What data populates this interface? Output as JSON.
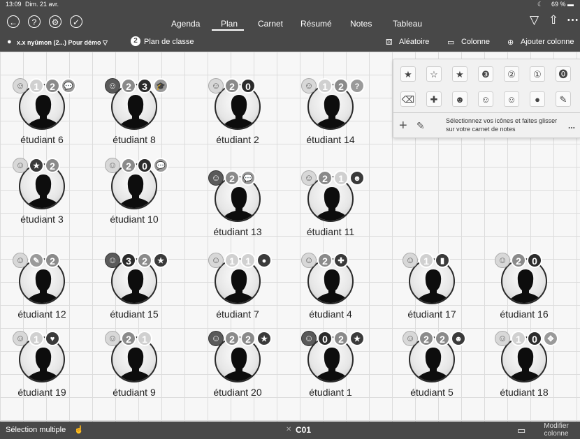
{
  "status": {
    "time": "13:09",
    "date": "Dim. 21 avr.",
    "battery": "69 %"
  },
  "nav": {
    "tabs": [
      {
        "label": "Agenda",
        "active": false
      },
      {
        "label": "Plan",
        "active": true
      },
      {
        "label": "Carnet",
        "active": false
      },
      {
        "label": "Résumé",
        "active": false
      },
      {
        "label": "Notes",
        "active": false
      },
      {
        "label": "Tableau",
        "active": false
      }
    ]
  },
  "subbar": {
    "class_selector": "x.x nyūmon (2...) Pour démo ▽",
    "plan_count": "2",
    "plan_label": "Plan de classe",
    "random_label": "Aléatoire",
    "column_label": "Colonne",
    "add_column_label": "Ajouter colonne"
  },
  "icon_panel": {
    "row1": [
      "star-grey",
      "star-light",
      "star-dark",
      "3",
      "2",
      "1",
      "0"
    ],
    "row2": [
      "delete",
      "plus",
      "smile-dark",
      "smile-mid",
      "smile-light",
      "circle-dark",
      "note"
    ],
    "hint": "Sélectionnez vos icônes et faites glisser sur votre carnet de notes",
    "more": "..."
  },
  "students": [
    {
      "name": "étudiant 6",
      "badges": [
        "smile",
        "1",
        "2",
        "speech"
      ]
    },
    {
      "name": "étudiant 8",
      "badges": [
        "smile-dark",
        "2",
        "3",
        "cap"
      ]
    },
    {
      "name": "étudiant 2",
      "badges": [
        "smile",
        "2",
        "0"
      ]
    },
    {
      "name": "étudiant 14",
      "badges": [
        "smile",
        "1",
        "2",
        "?"
      ]
    },
    {
      "name": "étudiant 3",
      "badges": [
        "smile",
        "star",
        "2"
      ]
    },
    {
      "name": "étudiant 10",
      "badges": [
        "smile",
        "2",
        "0",
        "speech"
      ]
    },
    {
      "name": "étudiant 13",
      "badges": [
        "smile-dark",
        "2",
        "speech"
      ]
    },
    {
      "name": "étudiant 11",
      "badges": [
        "smile",
        "2",
        "1",
        "group"
      ]
    },
    {
      "name": "étudiant 12",
      "badges": [
        "smile",
        "note",
        "2"
      ]
    },
    {
      "name": "étudiant 15",
      "badges": [
        "smile-dark",
        "3",
        "2",
        "star"
      ]
    },
    {
      "name": "étudiant 7",
      "badges": [
        "smile",
        "1",
        "1",
        "circle"
      ]
    },
    {
      "name": "étudiant 4",
      "badges": [
        "smile",
        "2",
        "plus"
      ]
    },
    {
      "name": "étudiant 17",
      "badges": [
        "smile",
        "1",
        "phone"
      ]
    },
    {
      "name": "étudiant 16",
      "badges": [
        "smile",
        "2",
        "0"
      ]
    },
    {
      "name": "étudiant 19",
      "badges": [
        "smile",
        "1",
        "heart"
      ]
    },
    {
      "name": "étudiant 9",
      "badges": [
        "smile",
        "2",
        "1"
      ]
    },
    {
      "name": "étudiant 20",
      "badges": [
        "smile-dark",
        "2",
        "2",
        "star"
      ]
    },
    {
      "name": "étudiant 1",
      "badges": [
        "smile-dark",
        "0",
        "2",
        "star"
      ]
    },
    {
      "name": "étudiant 5",
      "badges": [
        "smile",
        "2",
        "2",
        "group"
      ]
    },
    {
      "name": "étudiant 18",
      "badges": [
        "smile",
        "1",
        "0",
        "compass"
      ]
    }
  ],
  "bottom": {
    "multi_select": "Sélection multiple",
    "current": "C01",
    "edit_column": "Modifier colonne"
  }
}
